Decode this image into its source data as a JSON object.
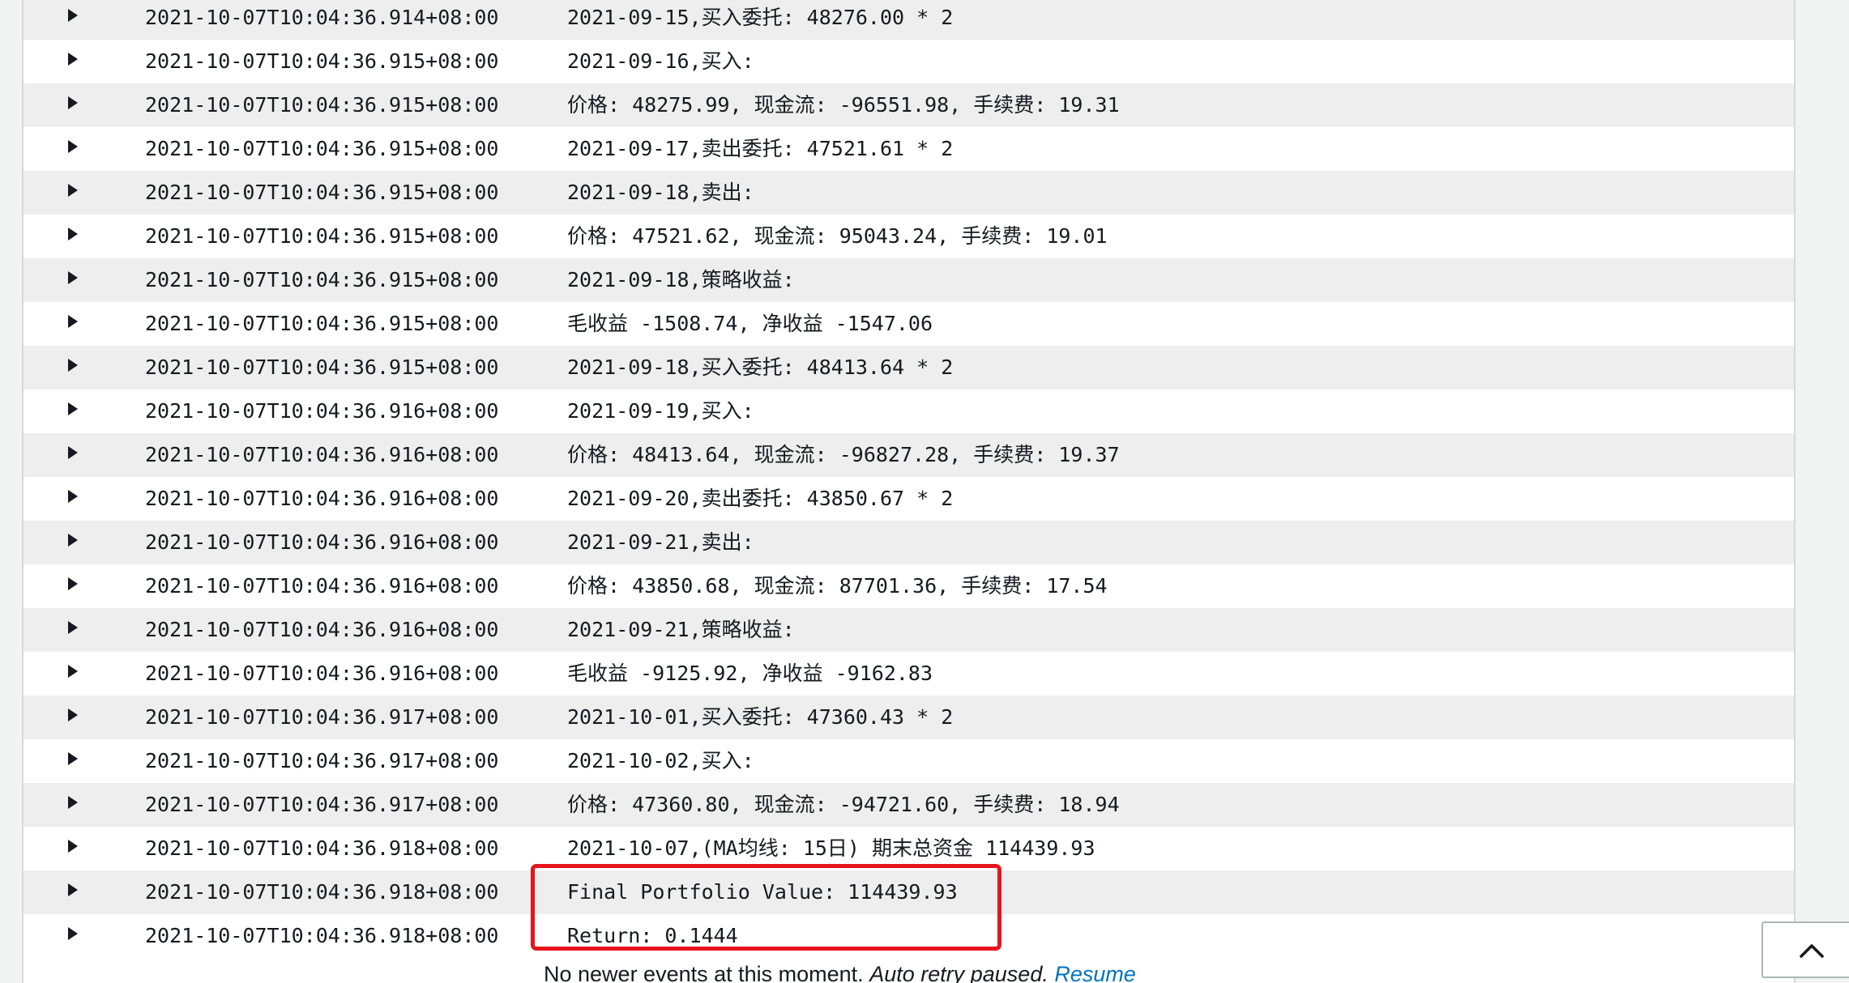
{
  "log": {
    "rows": [
      {
        "timestamp": "2021-10-07T10:04:36.914+08:00",
        "message": "2021-09-15,买入委托: 48276.00 * 2"
      },
      {
        "timestamp": "2021-10-07T10:04:36.915+08:00",
        "message": "2021-09-16,买入:"
      },
      {
        "timestamp": "2021-10-07T10:04:36.915+08:00",
        "message": "价格: 48275.99, 现金流: -96551.98, 手续费: 19.31"
      },
      {
        "timestamp": "2021-10-07T10:04:36.915+08:00",
        "message": "2021-09-17,卖出委托: 47521.61 * 2"
      },
      {
        "timestamp": "2021-10-07T10:04:36.915+08:00",
        "message": "2021-09-18,卖出:"
      },
      {
        "timestamp": "2021-10-07T10:04:36.915+08:00",
        "message": "价格: 47521.62, 现金流: 95043.24, 手续费: 19.01"
      },
      {
        "timestamp": "2021-10-07T10:04:36.915+08:00",
        "message": "2021-09-18,策略收益:"
      },
      {
        "timestamp": "2021-10-07T10:04:36.915+08:00",
        "message": "毛收益 -1508.74, 净收益 -1547.06"
      },
      {
        "timestamp": "2021-10-07T10:04:36.915+08:00",
        "message": "2021-09-18,买入委托: 48413.64 * 2"
      },
      {
        "timestamp": "2021-10-07T10:04:36.916+08:00",
        "message": "2021-09-19,买入:"
      },
      {
        "timestamp": "2021-10-07T10:04:36.916+08:00",
        "message": "价格: 48413.64, 现金流: -96827.28, 手续费: 19.37"
      },
      {
        "timestamp": "2021-10-07T10:04:36.916+08:00",
        "message": "2021-09-20,卖出委托: 43850.67 * 2"
      },
      {
        "timestamp": "2021-10-07T10:04:36.916+08:00",
        "message": "2021-09-21,卖出:"
      },
      {
        "timestamp": "2021-10-07T10:04:36.916+08:00",
        "message": "价格: 43850.68, 现金流: 87701.36, 手续费: 17.54"
      },
      {
        "timestamp": "2021-10-07T10:04:36.916+08:00",
        "message": "2021-09-21,策略收益:"
      },
      {
        "timestamp": "2021-10-07T10:04:36.916+08:00",
        "message": "毛收益 -9125.92, 净收益 -9162.83"
      },
      {
        "timestamp": "2021-10-07T10:04:36.917+08:00",
        "message": "2021-10-01,买入委托: 47360.43 * 2"
      },
      {
        "timestamp": "2021-10-07T10:04:36.917+08:00",
        "message": "2021-10-02,买入:"
      },
      {
        "timestamp": "2021-10-07T10:04:36.917+08:00",
        "message": "价格: 47360.80, 现金流: -94721.60, 手续费: 18.94"
      },
      {
        "timestamp": "2021-10-07T10:04:36.918+08:00",
        "message": "2021-10-07,(MA均线:  15日) 期末总资金 114439.93"
      },
      {
        "timestamp": "2021-10-07T10:04:36.918+08:00",
        "message": "Final Portfolio Value: 114439.93"
      },
      {
        "timestamp": "2021-10-07T10:04:36.918+08:00",
        "message": "Return: 0.1444"
      }
    ]
  },
  "footer": {
    "status_text": "No newer events at this moment.",
    "retry_text": "Auto retry paused.",
    "resume_label": "Resume"
  },
  "icons": {
    "row_toggle": "caret-right-icon",
    "scroll_top": "chevron-up-icon"
  },
  "colors": {
    "highlight_border": "#e8141c",
    "link": "#0073bb",
    "row_shaded": "#eeeeee",
    "row_white": "#ffffff"
  }
}
